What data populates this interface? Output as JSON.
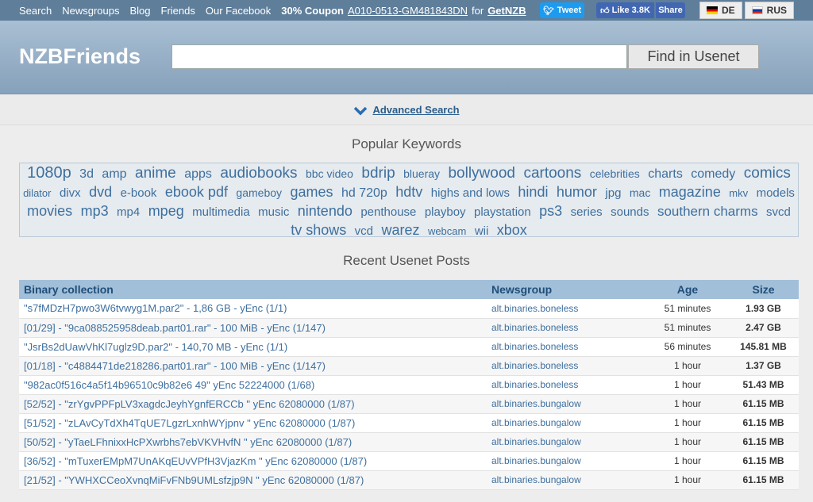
{
  "topnav": {
    "links": [
      "Search",
      "Newsgroups",
      "Blog",
      "Friends",
      "Our Facebook"
    ],
    "coupon_label": "30% Coupon",
    "coupon_code": "A010-0513-GM481843DN",
    "coupon_for": "for",
    "coupon_link": "GetNZB",
    "tweet": "Tweet",
    "like": "Like 3.8K",
    "share": "Share",
    "lang_de": "DE",
    "lang_ru": "RUS"
  },
  "header": {
    "logo": "NZBFriends",
    "search_value": "",
    "search_button": "Find in Usenet",
    "advanced": "Advanced Search"
  },
  "keywords": {
    "title": "Popular Keywords",
    "items": [
      {
        "t": "1080p",
        "s": 20
      },
      {
        "t": "3d",
        "s": 16
      },
      {
        "t": "amp",
        "s": 16
      },
      {
        "t": "anime",
        "s": 19
      },
      {
        "t": "apps",
        "s": 16
      },
      {
        "t": "audiobooks",
        "s": 19
      },
      {
        "t": "bbc video",
        "s": 14
      },
      {
        "t": "bdrip",
        "s": 19
      },
      {
        "t": "blueray",
        "s": 14
      },
      {
        "t": "bollywood",
        "s": 19
      },
      {
        "t": "cartoons",
        "s": 19
      },
      {
        "t": "celebrities",
        "s": 14
      },
      {
        "t": "charts",
        "s": 16
      },
      {
        "t": "comedy",
        "s": 16
      },
      {
        "t": "comics",
        "s": 19
      },
      {
        "t": "dilator",
        "s": 13
      },
      {
        "t": "divx",
        "s": 15
      },
      {
        "t": "dvd",
        "s": 18
      },
      {
        "t": "e-book",
        "s": 15
      },
      {
        "t": "ebook pdf",
        "s": 18
      },
      {
        "t": "gameboy",
        "s": 14
      },
      {
        "t": "games",
        "s": 18
      },
      {
        "t": "hd 720p",
        "s": 16
      },
      {
        "t": "hdtv",
        "s": 18
      },
      {
        "t": "highs and lows",
        "s": 15
      },
      {
        "t": "hindi",
        "s": 18
      },
      {
        "t": "humor",
        "s": 18
      },
      {
        "t": "jpg",
        "s": 15
      },
      {
        "t": "mac",
        "s": 14
      },
      {
        "t": "magazine",
        "s": 18
      },
      {
        "t": "mkv",
        "s": 13
      },
      {
        "t": "models",
        "s": 15
      },
      {
        "t": "movies",
        "s": 18
      },
      {
        "t": "mp3",
        "s": 18
      },
      {
        "t": "mp4",
        "s": 15
      },
      {
        "t": "mpeg",
        "s": 18
      },
      {
        "t": "multimedia",
        "s": 15
      },
      {
        "t": "music",
        "s": 15
      },
      {
        "t": "nintendo",
        "s": 18
      },
      {
        "t": "penthouse",
        "s": 15
      },
      {
        "t": "playboy",
        "s": 15
      },
      {
        "t": "playstation",
        "s": 15
      },
      {
        "t": "ps3",
        "s": 18
      },
      {
        "t": "series",
        "s": 15
      },
      {
        "t": "sounds",
        "s": 15
      },
      {
        "t": "southern charms",
        "s": 17
      },
      {
        "t": "svcd",
        "s": 15
      },
      {
        "t": "tv shows",
        "s": 18
      },
      {
        "t": "vcd",
        "s": 15
      },
      {
        "t": "warez",
        "s": 18
      },
      {
        "t": "webcam",
        "s": 13
      },
      {
        "t": "wii",
        "s": 15
      },
      {
        "t": "xbox",
        "s": 18
      }
    ]
  },
  "posts": {
    "title": "Recent Usenet Posts",
    "headers": [
      "Binary collection",
      "Newsgroup",
      "Age",
      "Size"
    ],
    "rows": [
      [
        "\"s7fMDzH7pwo3W6tvwyg1M.par2\" - 1,86 GB - yEnc (1/1)",
        "alt.binaries.boneless",
        "51 minutes",
        "1.93 GB"
      ],
      [
        "[01/29] - \"9ca088525958deab.part01.rar\" - 100 MiB - yEnc (1/147)",
        "alt.binaries.boneless",
        "51 minutes",
        "2.47 GB"
      ],
      [
        "\"JsrBs2dUawVhKl7uglz9D.par2\" - 140,70 MB - yEnc (1/1)",
        "alt.binaries.boneless",
        "56 minutes",
        "145.81 MB"
      ],
      [
        "[01/18] - \"c4884471de218286.part01.rar\" - 100 MiB - yEnc (1/147)",
        "alt.binaries.boneless",
        "1 hour",
        "1.37 GB"
      ],
      [
        "\"982ac0f516c4a5f14b96510c9b82e6 49\" yEnc 52224000 (1/68)",
        "alt.binaries.boneless",
        "1 hour",
        "51.43 MB"
      ],
      [
        "[52/52] - \"zrYgvPPFpLV3xagdcJeyhYgnfERCCb \" yEnc 62080000 (1/87)",
        "alt.binaries.bungalow",
        "1 hour",
        "61.15 MB"
      ],
      [
        "[51/52] - \"zLAvCyTdXh4TqUE7LgzrLxnhWYjpnv \" yEnc 62080000 (1/87)",
        "alt.binaries.bungalow",
        "1 hour",
        "61.15 MB"
      ],
      [
        "[50/52] - \"yTaeLFhnixxHcPXwrbhs7ebVKVHvfN \" yEnc 62080000 (1/87)",
        "alt.binaries.bungalow",
        "1 hour",
        "61.15 MB"
      ],
      [
        "[36/52] - \"mTuxerEMpM7UnAKqEUvVPfH3VjazKm \" yEnc 62080000 (1/87)",
        "alt.binaries.bungalow",
        "1 hour",
        "61.15 MB"
      ],
      [
        "[21/52] - \"YWHXCCeoXvnqMiFvFNb9UMLsfzjp9N \" yEnc 62080000 (1/87)",
        "alt.binaries.bungalow",
        "1 hour",
        "61.15 MB"
      ]
    ]
  }
}
